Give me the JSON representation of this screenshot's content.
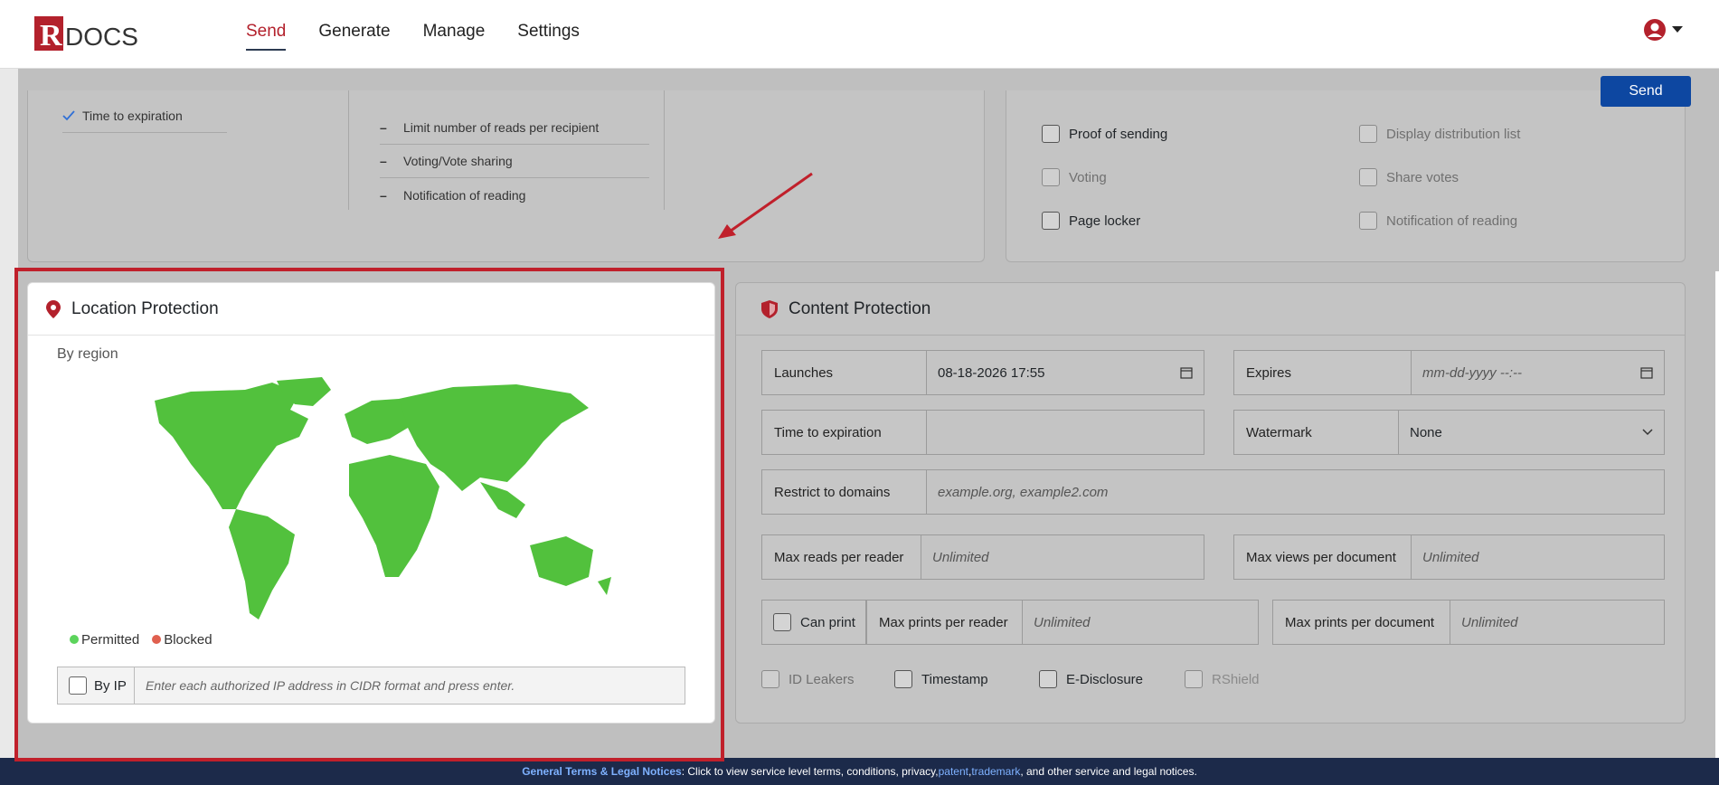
{
  "app": {
    "logo_text": "RDOCS",
    "nav": [
      "Send",
      "Generate",
      "Manage",
      "Settings"
    ],
    "active_nav": "Send",
    "send_button": "Send"
  },
  "top_left_card": {
    "checked_item": "Time to expiration",
    "list": [
      "Limit number of reads per recipient",
      "Voting/Vote sharing",
      "Notification of reading"
    ]
  },
  "top_right_card": {
    "left_options": [
      "Proof of sending",
      "Voting",
      "Page locker"
    ],
    "right_options": [
      "Display distribution list",
      "Share votes",
      "Notification of reading"
    ]
  },
  "location": {
    "title": "Location Protection",
    "by_region": "By region",
    "legend": [
      "Permitted",
      "Blocked"
    ],
    "legend_colors": [
      "#5cd45c",
      "#e0604f"
    ],
    "map_color": "#52c13d",
    "by_ip_label": "By IP",
    "ip_placeholder": "Enter each authorized IP address in CIDR format and press enter."
  },
  "content": {
    "title": "Content Protection",
    "launches_label": "Launches",
    "launches_value": "08-18-2026 17:55",
    "expires_label": "Expires",
    "expires_placeholder": "mm-dd-yyyy --:--",
    "time_to_expiration_label": "Time to expiration",
    "watermark_label": "Watermark",
    "watermark_value": "None",
    "restrict_label": "Restrict to domains",
    "restrict_placeholder": "example.org, example2.com",
    "max_reads_label": "Max reads per reader",
    "max_reads_value": "Unlimited",
    "max_views_label": "Max views per document",
    "max_views_value": "Unlimited",
    "can_print_label": "Can print",
    "max_prints_reader_label": "Max prints per reader",
    "max_prints_reader_value": "Unlimited",
    "max_prints_doc_label": "Max prints per document",
    "max_prints_doc_value": "Unlimited",
    "options": [
      "ID Leakers",
      "Timestamp",
      "E-Disclosure",
      "RShield"
    ]
  },
  "footer": {
    "terms_link": "General Terms & Legal Notices",
    "text1": ": Click to view service level terms, conditions, privacy, ",
    "patent": "patent",
    "sep": ", ",
    "trademark": "trademark",
    "text2": ", and other service and legal notices."
  }
}
